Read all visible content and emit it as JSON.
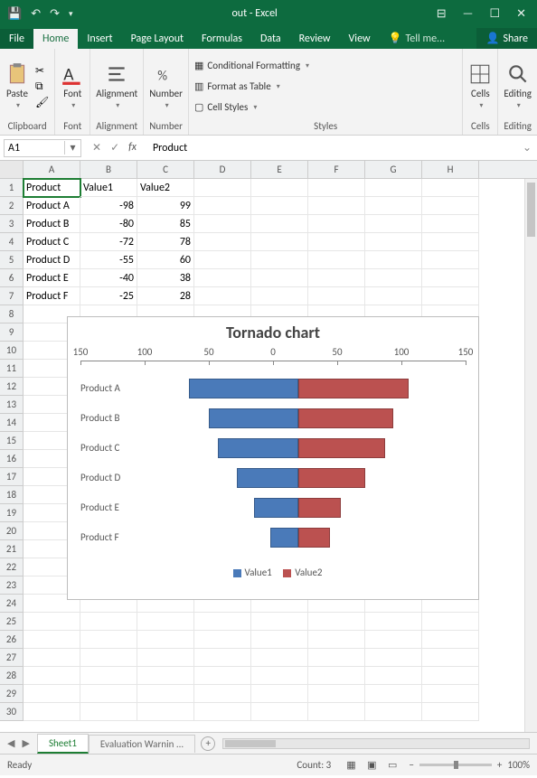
{
  "app_title": "out - Excel",
  "menu": {
    "file": "File",
    "home": "Home",
    "insert": "Insert",
    "page_layout": "Page Layout",
    "formulas": "Formulas",
    "data": "Data",
    "review": "Review",
    "view": "View",
    "tellme": "Tell me...",
    "share": "Share"
  },
  "ribbon": {
    "clipboard": {
      "label": "Clipboard",
      "paste": "Paste"
    },
    "font": {
      "label": "Font"
    },
    "alignment": {
      "label": "Alignment"
    },
    "number": {
      "label": "Number"
    },
    "styles": {
      "label": "Styles",
      "cond": "Conditional Formatting",
      "table": "Format as Table",
      "cell": "Cell Styles"
    },
    "cells": {
      "label": "Cells"
    },
    "editing": {
      "label": "Editing"
    }
  },
  "namebox": "A1",
  "formula_value": "Product",
  "grid": {
    "cols": [
      "A",
      "B",
      "C",
      "D",
      "E",
      "F",
      "G",
      "H"
    ],
    "rows": 30,
    "data": [
      [
        "Product",
        "Value1",
        "Value2"
      ],
      [
        "Product A",
        "-98",
        "99"
      ],
      [
        "Product B",
        "-80",
        "85"
      ],
      [
        "Product C",
        "-72",
        "78"
      ],
      [
        "Product D",
        "-55",
        "60"
      ],
      [
        "Product E",
        "-40",
        "38"
      ],
      [
        "Product F",
        "-25",
        "28"
      ]
    ]
  },
  "sheets": {
    "active": "Sheet1",
    "other": "Evaluation Warnin"
  },
  "status": {
    "ready": "Ready",
    "count": "Count: 3",
    "zoom": "100%"
  },
  "chart_data": {
    "type": "bar",
    "title": "Tornado chart",
    "categories": [
      "Product A",
      "Product B",
      "Product C",
      "Product D",
      "Product E",
      "Product F"
    ],
    "series": [
      {
        "name": "Value1",
        "values": [
          -98,
          -80,
          -72,
          -55,
          -40,
          -25
        ],
        "color": "#4a7ab9"
      },
      {
        "name": "Value2",
        "values": [
          99,
          85,
          78,
          60,
          38,
          28
        ],
        "color": "#bb5150"
      }
    ],
    "xlim": [
      -150,
      150
    ],
    "xticks": [
      -150,
      -100,
      -50,
      0,
      50,
      100,
      150
    ],
    "xtick_labels": [
      "150",
      "100",
      "50",
      "0",
      "50",
      "100",
      "150"
    ]
  }
}
